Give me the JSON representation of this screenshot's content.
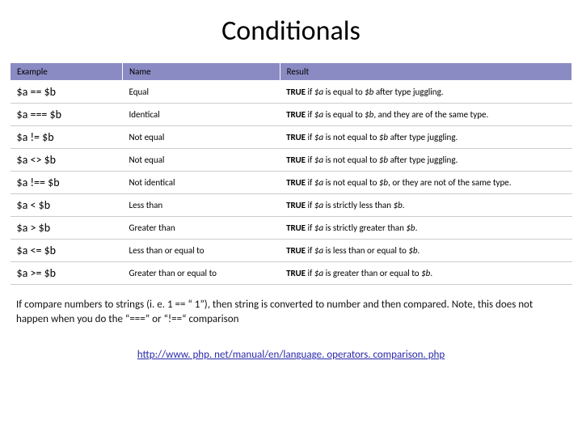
{
  "title": "Conditionals",
  "columns": [
    "Example",
    "Name",
    "Result"
  ],
  "rows": [
    {
      "example": "$a == $b",
      "name": "Equal",
      "result_parts": [
        {
          "t": "TRUE",
          "c": "b"
        },
        {
          "t": " if "
        },
        {
          "t": "$a",
          "c": "i"
        },
        {
          "t": " is equal to "
        },
        {
          "t": "$b",
          "c": "i"
        },
        {
          "t": " after type juggling."
        }
      ]
    },
    {
      "example": "$a === $b",
      "name": "Identical",
      "result_parts": [
        {
          "t": "TRUE",
          "c": "b"
        },
        {
          "t": " if "
        },
        {
          "t": "$a",
          "c": "i"
        },
        {
          "t": " is equal to "
        },
        {
          "t": "$b",
          "c": "i"
        },
        {
          "t": ", and they are of the same type."
        }
      ]
    },
    {
      "example": "$a != $b",
      "name": "Not equal",
      "result_parts": [
        {
          "t": "TRUE",
          "c": "b"
        },
        {
          "t": " if "
        },
        {
          "t": "$a",
          "c": "i"
        },
        {
          "t": " is not equal to "
        },
        {
          "t": "$b",
          "c": "i"
        },
        {
          "t": " after type juggling."
        }
      ]
    },
    {
      "example": "$a <> $b",
      "name": "Not equal",
      "result_parts": [
        {
          "t": "TRUE",
          "c": "b"
        },
        {
          "t": " if "
        },
        {
          "t": "$a",
          "c": "i"
        },
        {
          "t": " is not equal to "
        },
        {
          "t": "$b",
          "c": "i"
        },
        {
          "t": " after type juggling."
        }
      ]
    },
    {
      "example": "$a !== $b",
      "name": "Not identical",
      "result_parts": [
        {
          "t": "TRUE",
          "c": "b"
        },
        {
          "t": " if "
        },
        {
          "t": "$a",
          "c": "i"
        },
        {
          "t": " is not equal to "
        },
        {
          "t": "$b",
          "c": "i"
        },
        {
          "t": ", or they are not of the same type."
        }
      ]
    },
    {
      "example": "$a < $b",
      "name": "Less than",
      "result_parts": [
        {
          "t": "TRUE",
          "c": "b"
        },
        {
          "t": " if "
        },
        {
          "t": "$a",
          "c": "i"
        },
        {
          "t": " is strictly less than "
        },
        {
          "t": "$b",
          "c": "i"
        },
        {
          "t": "."
        }
      ]
    },
    {
      "example": "$a > $b",
      "name": "Greater than",
      "result_parts": [
        {
          "t": "TRUE",
          "c": "b"
        },
        {
          "t": " if "
        },
        {
          "t": "$a",
          "c": "i"
        },
        {
          "t": " is strictly greater than "
        },
        {
          "t": "$b",
          "c": "i"
        },
        {
          "t": "."
        }
      ]
    },
    {
      "example": "$a <= $b",
      "name": "Less than or equal to",
      "result_parts": [
        {
          "t": "TRUE",
          "c": "b"
        },
        {
          "t": " if "
        },
        {
          "t": "$a",
          "c": "i"
        },
        {
          "t": " is less than or equal to "
        },
        {
          "t": "$b",
          "c": "i"
        },
        {
          "t": "."
        }
      ]
    },
    {
      "example": "$a >= $b",
      "name": "Greater than or equal to",
      "result_parts": [
        {
          "t": "TRUE",
          "c": "b"
        },
        {
          "t": " if "
        },
        {
          "t": "$a",
          "c": "i"
        },
        {
          "t": " is greater than or equal to "
        },
        {
          "t": "$b",
          "c": "i"
        },
        {
          "t": "."
        }
      ]
    }
  ],
  "note": "If compare numbers to strings (i. e. 1 == “ 1”), then string is converted to number and then compared. Note, this does not happen when you do the “===” or “!==“ comparison",
  "link_text": "http://www. php. net/manual/en/language. operators. comparison. php",
  "link_href": "http://www.php.net/manual/en/language.operators.comparison.php"
}
